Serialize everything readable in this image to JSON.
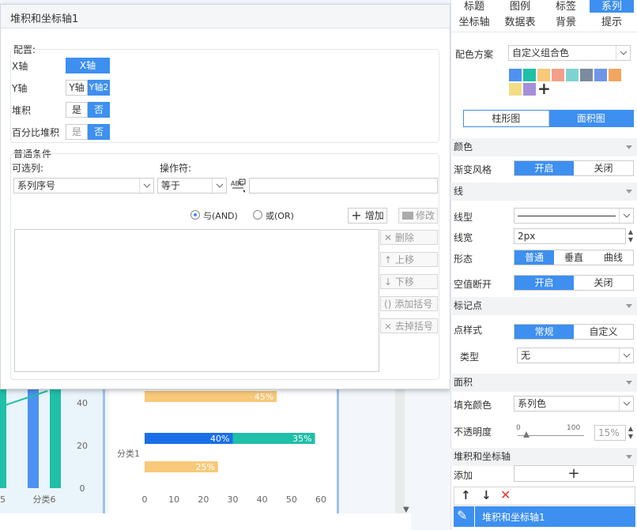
{
  "dialog": {
    "title": "堆积和坐标轴1",
    "config_title": "配置:",
    "x_axis_label": "X轴",
    "x_axis_value": "X轴",
    "y_axis_label": "Y轴",
    "y_axis_options": [
      "Y轴",
      "Y轴2"
    ],
    "stack_label": "堆积",
    "stack_options": [
      "是",
      "否"
    ],
    "percent_stack_label": "百分比堆积",
    "percent_stack_options": [
      "是",
      "否"
    ],
    "condition_title": "普通条件",
    "column_label": "可选列:",
    "column_value": "系列序号",
    "operator_label": "操作符:",
    "operator_value": "等于",
    "value_input": "",
    "and_label": "与(AND)",
    "or_label": "或(OR)",
    "add_button": "增加",
    "modify_button": "修改",
    "delete_button": "删除",
    "up_button": "上移",
    "down_button": "下移",
    "add_bracket_button": "添加括号",
    "remove_bracket_button": "去掉括号"
  },
  "right_panel": {
    "tabs_row1": [
      "标题",
      "图例",
      "标签",
      "系列"
    ],
    "tabs_row2": [
      "坐标轴",
      "数据表",
      "背景",
      "提示"
    ],
    "active_tab": "系列",
    "color_scheme_label": "配色方案",
    "color_scheme_value": "自定义组合色",
    "swatches": [
      "#4e91f0",
      "#1fbfa8",
      "#f8c97a",
      "#f29f8a",
      "#7ed3d0",
      "#7c8aa0",
      "#6f96e6",
      "#f2a65e",
      "#f3dd84",
      "#a58fd8"
    ],
    "chart_types": [
      "柱形图",
      "面积图"
    ],
    "active_chart_type": "面积图",
    "color_section": "颜色",
    "gradient_label": "渐变风格",
    "gradient_options": [
      "开启",
      "关闭"
    ],
    "line_section": "线",
    "line_type_label": "线型",
    "line_width_label": "线宽",
    "line_width_value": "2px",
    "shape_label": "形态",
    "shape_options": [
      "普通",
      "垂直",
      "曲线"
    ],
    "null_break_label": "空值断开",
    "null_break_options": [
      "开启",
      "关闭"
    ],
    "marker_section": "标记点",
    "point_style_label": "点样式",
    "point_style_options": [
      "常规",
      "自定义"
    ],
    "type_label": "类型",
    "type_value": "无",
    "area_section": "面积",
    "fill_color_label": "填充颜色",
    "fill_color_value": "系列色",
    "opacity_label": "不透明度",
    "opacity_min": "0",
    "opacity_max": "100",
    "opacity_value": "15%",
    "stack_axis_section": "堆积和坐标轴",
    "add_label": "添加",
    "list_item": "堆积和坐标轴1"
  },
  "chart_data": [
    {
      "type": "bar",
      "categories": [
        "5",
        "分类6"
      ],
      "yticks": [
        "40",
        "20",
        "0"
      ]
    },
    {
      "type": "bar",
      "orientation": "horizontal",
      "categories": [
        "分类1"
      ],
      "xticks": [
        "0",
        "10",
        "20",
        "30",
        "40",
        "50",
        "60"
      ],
      "xlim": [
        0,
        60
      ],
      "bars": [
        {
          "label": "45%",
          "start": 0,
          "value": 45,
          "color": "#f8c97a"
        },
        {
          "label": "40%",
          "start": 0,
          "value": 30,
          "color": "#1a6fe8"
        },
        {
          "label": "35%",
          "start": 30,
          "value": 28,
          "color": "#1fbfa8"
        },
        {
          "label": "25%",
          "start": 0,
          "value": 25,
          "color": "#f8c97a"
        }
      ]
    }
  ]
}
